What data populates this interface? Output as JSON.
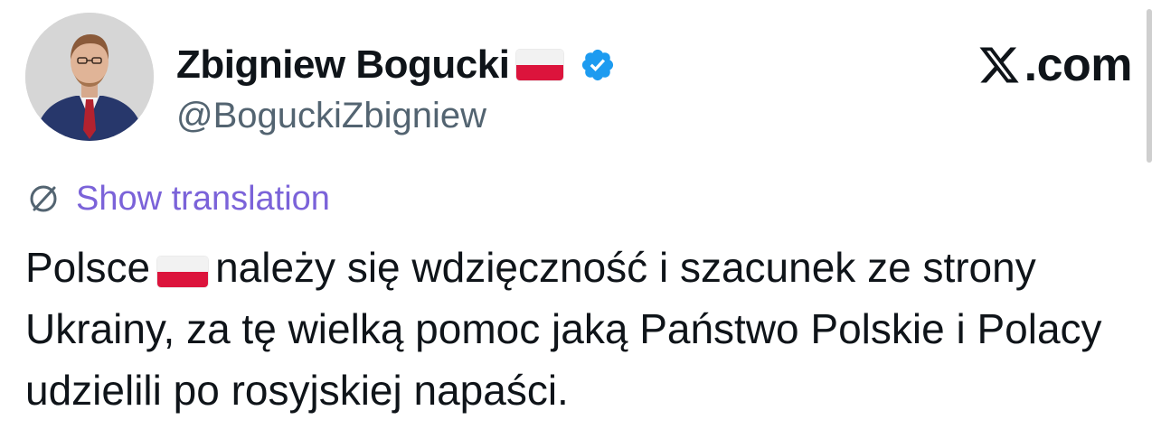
{
  "author": {
    "name": "Zbigniew Bogucki",
    "handle": "@BoguckiZbigniew",
    "verified": true,
    "flag": "poland-flag"
  },
  "site_logo": {
    "text": ".com",
    "icon": "x-logo-icon"
  },
  "translation": {
    "label": "Show translation",
    "icon": "globe-icon",
    "color": "#7b63d9"
  },
  "tweet": {
    "text_before_flag": "Polsce",
    "flag": "poland-flag",
    "text_after_flag": "należy się wdzięczność i szacunek ze strony Ukrainy, za tę wielką pomoc jaką Państwo Polskie i Polacy udzielili po rosyjskiej napaści."
  },
  "colors": {
    "text": "#0f1419",
    "secondary_text": "#536471",
    "verified_badge": "#1d9bf0",
    "flag_red": "#dc143c",
    "flag_white": "#f2f2f2"
  }
}
